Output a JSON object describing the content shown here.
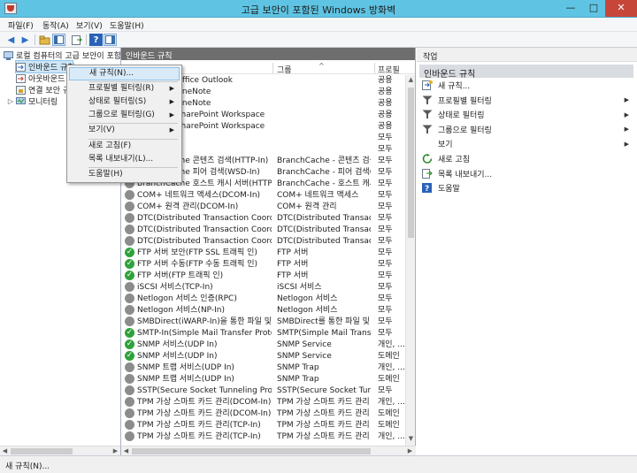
{
  "window": {
    "title": "고급 보안이 포함된 Windows 방화벽",
    "min_glyph": "—",
    "max_glyph": "□",
    "close_glyph": "✕"
  },
  "menubar": [
    "파일(F)",
    "동작(A)",
    "보기(V)",
    "도움말(H)"
  ],
  "tree": {
    "root": "로컬 컴퓨터의 고급 보안이 포함",
    "items": [
      "인바운드 규칙",
      "아웃바운드 규칙",
      "연결 보안 규칙",
      "모니터링"
    ]
  },
  "center": {
    "title": "인바운드 규칙",
    "columns": [
      "이름",
      "그룹",
      "프로필"
    ],
    "rows": [
      {
        "name": "Microsoft Office Outlook",
        "group": "",
        "profile": "공용",
        "enabled": true
      },
      {
        "name": "Microsoft OneNote",
        "group": "",
        "profile": "공용",
        "enabled": true
      },
      {
        "name": "Microsoft OneNote",
        "group": "",
        "profile": "공용",
        "enabled": true
      },
      {
        "name": "Microsoft SharePoint Workspace",
        "group": "",
        "profile": "공용",
        "enabled": true
      },
      {
        "name": "Microsoft SharePoint Workspace",
        "group": "",
        "profile": "공용",
        "enabled": true
      },
      {
        "name": "",
        "group": "",
        "profile": "모두",
        "enabled": true
      },
      {
        "name": "",
        "group": "",
        "profile": "모두",
        "enabled": true
      },
      {
        "name": "BranchCache 콘텐츠 검색(HTTP-In)",
        "group": "BranchCache - 콘텐츠 검색...",
        "profile": "모두",
        "enabled": false
      },
      {
        "name": "BranchCache 피어 검색(WSD-In)",
        "group": "BranchCache - 피어 검색(...",
        "profile": "모두",
        "enabled": false
      },
      {
        "name": "BranchCache 호스트 캐시 서버(HTTP-In)",
        "group": "BranchCache - 호스트 캐시 ...",
        "profile": "모두",
        "enabled": false
      },
      {
        "name": "COM+ 네트워크 액세스(DCOM-In)",
        "group": "COM+ 네트워크 액세스",
        "profile": "모두",
        "enabled": false
      },
      {
        "name": "COM+ 원격 관리(DCOM-In)",
        "group": "COM+ 원격 관리",
        "profile": "모두",
        "enabled": false
      },
      {
        "name": "DTC(Distributed Transaction Coordinato...",
        "group": "DTC(Distributed Transactio...",
        "profile": "모두",
        "enabled": false
      },
      {
        "name": "DTC(Distributed Transaction Coordinato...",
        "group": "DTC(Distributed Transactio...",
        "profile": "모두",
        "enabled": false
      },
      {
        "name": "DTC(Distributed Transaction Coordinato...",
        "group": "DTC(Distributed Transactio...",
        "profile": "모두",
        "enabled": false
      },
      {
        "name": "FTP 서버 보안(FTP SSL 트래픽 인)",
        "group": "FTP 서버",
        "profile": "모두",
        "enabled": true
      },
      {
        "name": "FTP 서버 수동(FTP 수동 트래픽 인)",
        "group": "FTP 서버",
        "profile": "모두",
        "enabled": true
      },
      {
        "name": "FTP 서버(FTP 트래픽 인)",
        "group": "FTP 서버",
        "profile": "모두",
        "enabled": true
      },
      {
        "name": "iSCSI 서비스(TCP-In)",
        "group": "iSCSI 서비스",
        "profile": "모두",
        "enabled": false
      },
      {
        "name": "Netlogon 서비스 인증(RPC)",
        "group": "Netlogon 서비스",
        "profile": "모두",
        "enabled": false
      },
      {
        "name": "Netlogon 서비스(NP-In)",
        "group": "Netlogon 서비스",
        "profile": "모두",
        "enabled": false
      },
      {
        "name": "SMBDirect(iWARP-In)을 통한 파일 및 프...",
        "group": "SMBDirect를 통한 파일 및 ...",
        "profile": "모두",
        "enabled": false
      },
      {
        "name": "SMTP-In(Simple Mail Transfer Protocol)",
        "group": "SMTP(Simple Mail Transfer ...",
        "profile": "모두",
        "enabled": true
      },
      {
        "name": "SNMP 서비스(UDP In)",
        "group": "SNMP Service",
        "profile": "개인, ...",
        "enabled": true
      },
      {
        "name": "SNMP 서비스(UDP In)",
        "group": "SNMP Service",
        "profile": "도메인",
        "enabled": true
      },
      {
        "name": "SNMP 트랩 서비스(UDP In)",
        "group": "SNMP Trap",
        "profile": "개인, ...",
        "enabled": false
      },
      {
        "name": "SNMP 트랩 서비스(UDP In)",
        "group": "SNMP Trap",
        "profile": "도메인",
        "enabled": false
      },
      {
        "name": "SSTP(Secure Socket Tunneling Protocol)...",
        "group": "SSTP(Secure Socket Tunnel...",
        "profile": "모두",
        "enabled": false
      },
      {
        "name": "TPM 가상 스마트 카드 관리(DCOM-In)",
        "group": "TPM 가상 스마트 카드 관리",
        "profile": "개인, ...",
        "enabled": false
      },
      {
        "name": "TPM 가상 스마트 카드 관리(DCOM-In)",
        "group": "TPM 가상 스마트 카드 관리",
        "profile": "도메인",
        "enabled": false
      },
      {
        "name": "TPM 가상 스마트 카드 관리(TCP-In)",
        "group": "TPM 가상 스마트 카드 관리",
        "profile": "도메인",
        "enabled": false
      },
      {
        "name": "TPM 가상 스마트 카드 관리(TCP-In)",
        "group": "TPM 가상 스마트 카드 관리",
        "profile": "개인, ...",
        "enabled": false
      }
    ]
  },
  "actions": {
    "title": "작업",
    "section": "인바운드 규칙",
    "items": [
      {
        "label": "새 규칙...",
        "icon": "new-rule-icon",
        "submenu": false
      },
      {
        "label": "프로필별 필터링",
        "icon": "filter-icon",
        "submenu": true
      },
      {
        "label": "상태로 필터링",
        "icon": "filter-icon",
        "submenu": true
      },
      {
        "label": "그룹으로 필터링",
        "icon": "filter-icon",
        "submenu": true
      },
      {
        "label": "보기",
        "icon": "",
        "submenu": true
      },
      {
        "label": "새로 고침",
        "icon": "refresh-icon",
        "submenu": false
      },
      {
        "label": "목록 내보내기...",
        "icon": "export-icon",
        "submenu": false
      },
      {
        "label": "도움말",
        "icon": "help-icon",
        "submenu": false
      }
    ]
  },
  "context_menu": {
    "items": [
      "새 규칙(N)...",
      "프로필별 필터링(R)",
      "상태로 필터링(S)",
      "그룹으로 필터링(G)",
      "보기(V)",
      "새로 고침(F)",
      "목록 내보내기(L)...",
      "도움말(H)"
    ]
  },
  "statusbar": "새 규칙(N)..."
}
